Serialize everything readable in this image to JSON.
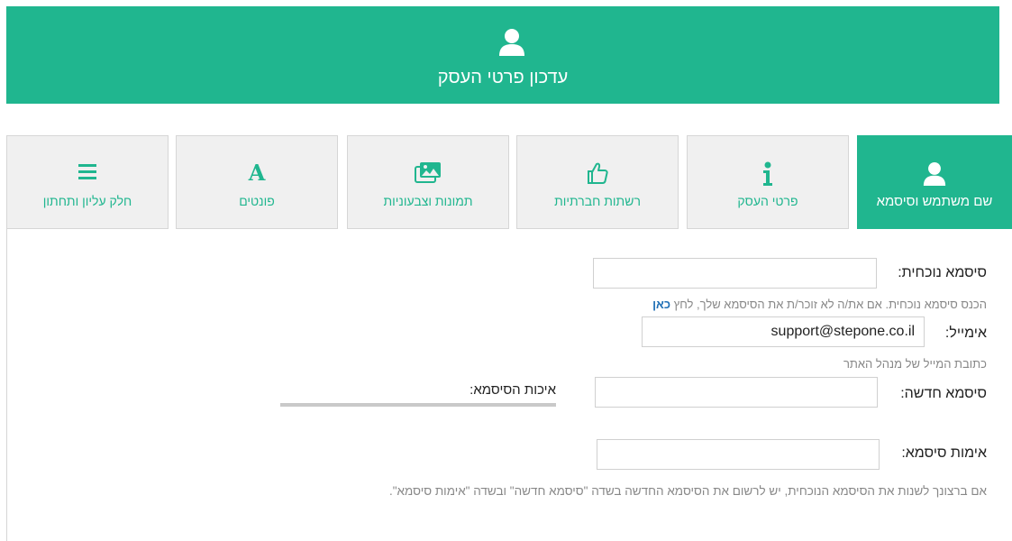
{
  "header": {
    "title": "עדכון פרטי העסק",
    "icon": "user-icon"
  },
  "tabs": [
    {
      "label": "שם משתמש וסיסמא",
      "icon": "user-icon",
      "active": true
    },
    {
      "label": "פרטי העסק",
      "icon": "info-icon",
      "active": false
    },
    {
      "label": "רשתות חברתיות",
      "icon": "thumbs-up-icon",
      "active": false
    },
    {
      "label": "תמונות וצבעוניות",
      "icon": "images-icon",
      "active": false
    },
    {
      "label": "פונטים",
      "icon": "font-icon",
      "active": false
    },
    {
      "label": "חלק עליון ותחתון",
      "icon": "menu-icon",
      "active": false
    }
  ],
  "form": {
    "current_password": {
      "label": "סיסמא נוכחית:",
      "value": "",
      "help_text": "הכנס סיסמא נוכחית. אם את/ה לא זוכר/ת את הסיסמא שלך, לחץ",
      "help_link": "כאן"
    },
    "email": {
      "label": "אימייל:",
      "value": "support@stepone.co.il",
      "help_text": "כתובת המייל של מנהל האתר"
    },
    "new_password": {
      "label": "סיסמא חדשה:",
      "value": "",
      "strength_label": "איכות הסיסמא:"
    },
    "confirm_password": {
      "label": "אימות סיסמא:",
      "value": ""
    },
    "footer_note": "אם ברצונך לשנות את הסיסמא הנוכחית, יש לרשום את הסיסמא החדשה בשדה \"סיסמא חדשה\" ובשדה \"אימות סיסמא\"."
  },
  "colors": {
    "accent": "#20b68f",
    "link": "#1f6fb5",
    "tab_bg": "#f0f0f0"
  }
}
